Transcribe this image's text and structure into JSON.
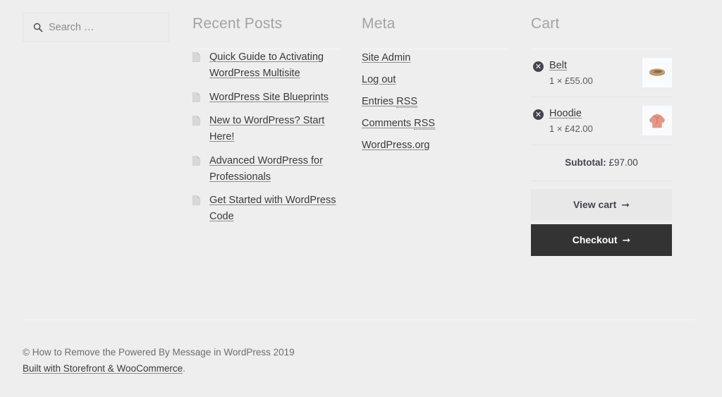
{
  "search": {
    "placeholder": "Search …",
    "value": "",
    "icon": "search-icon"
  },
  "recent_posts": {
    "title": "Recent Posts",
    "item_icon": "document-icon",
    "items": [
      {
        "label": "Quick Guide to Activating WordPress Multisite"
      },
      {
        "label": "WordPress Site Blueprints"
      },
      {
        "label": "New to WordPress? Start Here!"
      },
      {
        "label": "Advanced WordPress for Professionals"
      },
      {
        "label": "Get Started with WordPress Code"
      }
    ]
  },
  "meta": {
    "title": "Meta",
    "items": [
      {
        "label": "Site Admin"
      },
      {
        "label": "Log out"
      },
      {
        "label": "Entries RSS",
        "abbr": "RSS"
      },
      {
        "label": "Comments RSS",
        "abbr": "RSS"
      },
      {
        "label": "WordPress.org"
      }
    ]
  },
  "cart": {
    "title": "Cart",
    "remove_icon": "remove-circle-icon",
    "remove_glyph": "✕",
    "items": [
      {
        "name": "Belt",
        "quantity_price": "1 × £55.00",
        "thumbnail": "belt-thumbnail"
      },
      {
        "name": "Hoodie",
        "quantity_price": "1 × £42.00",
        "thumbnail": "hoodie-thumbnail"
      }
    ],
    "subtotal_label": "Subtotal:",
    "subtotal_value": "£97.00",
    "view_cart_label": "View cart",
    "checkout_label": "Checkout",
    "arrow_glyph": "➞"
  },
  "footer": {
    "copyright": "© How to Remove the Powered By Message in WordPress 2019",
    "built_with": "Built with Storefront & WooCommerce",
    "built_with_period": "."
  },
  "colors": {
    "background": "#eeeeee",
    "text": "#43454b",
    "heading": "#a3a3a3",
    "rule": "#e3e3e3",
    "checkout_button": "#333333",
    "view_cart_button": "#e8e8e8"
  }
}
